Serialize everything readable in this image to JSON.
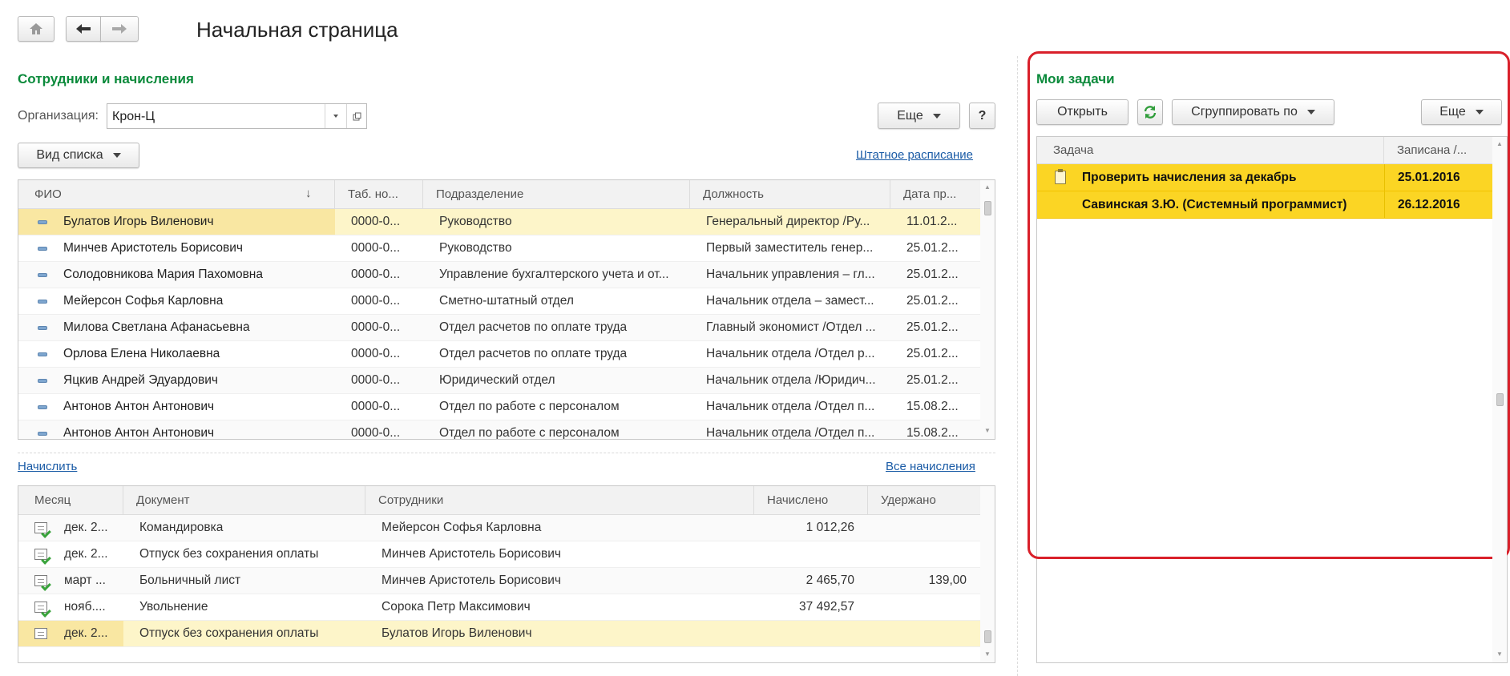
{
  "page_title": "Начальная страница",
  "icons": {
    "home": "home-icon",
    "back": "arrow-left-icon",
    "forward": "arrow-right-icon",
    "refresh": "refresh-icon",
    "clipboard": "clipboard-icon",
    "link": "open-link-icon"
  },
  "colors": {
    "section_title": "#0b8a3b",
    "selected_row": "#fdf5c9",
    "task_highlight": "#fbd524",
    "focus_frame": "#d9202a",
    "link": "#1a5ba6"
  },
  "employees": {
    "title": "Сотрудники и начисления",
    "org_label": "Организация:",
    "org_value": "Крон-Ц",
    "more_button": "Еще",
    "help_button": "?",
    "view_button": "Вид списка",
    "staffing_link": "Штатное расписание",
    "columns": [
      "ФИО",
      "Таб. но...",
      "Подразделение",
      "Должность",
      "Дата пр..."
    ],
    "rows": [
      {
        "name": "Булатов Игорь Виленович",
        "tab": "0000-0...",
        "dept": "Руководство",
        "position": "Генеральный директор /Ру...",
        "date": "11.01.2..."
      },
      {
        "name": "Минчев Аристотель Борисович",
        "tab": "0000-0...",
        "dept": "Руководство",
        "position": "Первый заместитель генер...",
        "date": "25.01.2..."
      },
      {
        "name": "Солодовникова Мария Пахомовна",
        "tab": "0000-0...",
        "dept": "Управление бухгалтерского учета и от...",
        "position": "Начальник управления – гл...",
        "date": "25.01.2..."
      },
      {
        "name": "Мейерсон Софья Карловна",
        "tab": "0000-0...",
        "dept": "Сметно-штатный отдел",
        "position": "Начальник отдела – замест...",
        "date": "25.01.2..."
      },
      {
        "name": "Милова Светлана Афанасьевна",
        "tab": "0000-0...",
        "dept": "Отдел расчетов по оплате труда",
        "position": "Главный экономист /Отдел ...",
        "date": "25.01.2..."
      },
      {
        "name": "Орлова Елена Николаевна",
        "tab": "0000-0...",
        "dept": "Отдел расчетов по оплате труда",
        "position": "Начальник отдела /Отдел р...",
        "date": "25.01.2..."
      },
      {
        "name": "Яцкив Андрей Эдуардович",
        "tab": "0000-0...",
        "dept": "Юридический отдел",
        "position": "Начальник отдела /Юридич...",
        "date": "25.01.2..."
      },
      {
        "name": "Антонов Антон Антонович",
        "tab": "0000-0...",
        "dept": "Отдел по работе с персоналом",
        "position": "Начальник отдела /Отдел п...",
        "date": "15.08.2..."
      },
      {
        "name": "Антонов Антон Антонович",
        "tab": "0000-0...",
        "dept": "Отдел по работе с персоналом",
        "position": "Начальник отдела /Отдел п...",
        "date": "15.08.2..."
      }
    ]
  },
  "accruals": {
    "accrue_link": "Начислить",
    "all_link": "Все начисления",
    "columns": [
      "Месяц",
      "Документ",
      "Сотрудники",
      "Начислено",
      "Удержано"
    ],
    "rows": [
      {
        "month": "дек. 2...",
        "doc": "Командировка",
        "employees": "Мейерсон Софья Карловна",
        "accrued": "1 012,26",
        "withheld": ""
      },
      {
        "month": "дек. 2...",
        "doc": "Отпуск без сохранения оплаты",
        "employees": "Минчев Аристотель Борисович",
        "accrued": "",
        "withheld": ""
      },
      {
        "month": "март ...",
        "doc": "Больничный лист",
        "employees": "Минчев Аристотель Борисович",
        "accrued": "2 465,70",
        "withheld": "139,00"
      },
      {
        "month": "нояб....",
        "doc": "Увольнение",
        "employees": "Сорока Петр Максимович",
        "accrued": "37 492,57",
        "withheld": ""
      },
      {
        "month": "дек. 2...",
        "doc": "Отпуск без сохранения оплаты",
        "employees": "Булатов Игорь Виленович",
        "accrued": "",
        "withheld": ""
      }
    ]
  },
  "tasks": {
    "title": "Мои задачи",
    "open_button": "Открыть",
    "group_button": "Сгруппировать по",
    "more_button": "Еще",
    "columns": [
      "Задача",
      "Записана /..."
    ],
    "rows": [
      {
        "task": "Проверить начисления за декабрь",
        "date": "25.01.2016"
      },
      {
        "task": "Савинская З.Ю. (Системный программист)",
        "date": "26.12.2016"
      }
    ]
  }
}
